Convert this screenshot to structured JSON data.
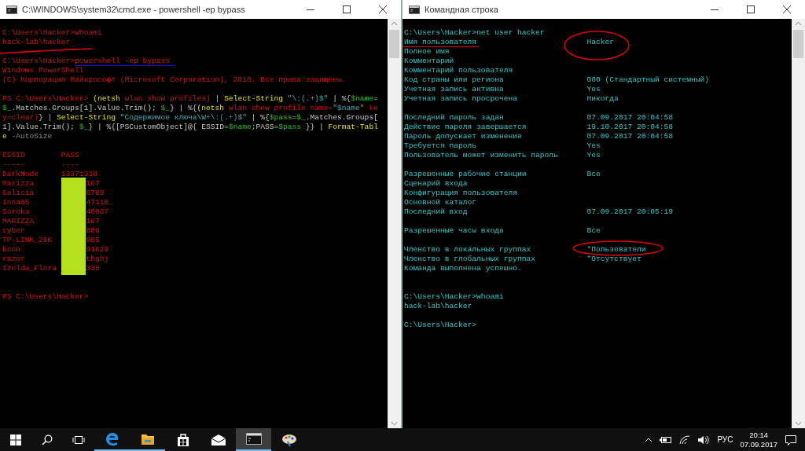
{
  "windows": [
    {
      "title": "C:\\WINDOWS\\system32\\cmd.exe - powershell  -ep bypass",
      "kind": "powershell",
      "blocks": [
        {
          "kind": "output",
          "lines": [
            [
              {
                "kind": "text",
                "text": "C:\\Users\\Hacker>whoami"
              }
            ],
            [
              {
                "kind": "text",
                "text": "hack-lab\\hacker"
              }
            ]
          ]
        },
        {
          "kind": "output",
          "lines": [
            [
              {
                "kind": "text",
                "text": "C:\\Users\\Hacker>powershell -ep bypass"
              }
            ],
            [
              {
                "kind": "text",
                "text": "Windows PowerShell"
              }
            ],
            [
              {
                "kind": "text",
                "text": "(C) Корпорация Майкрософт (Microsoft Corporation), 2016. Все права защищены."
              }
            ]
          ]
        },
        {
          "kind": "output",
          "lines": [
            [
              {
                "kind": "text",
                "text": "PS C:\\Users\\Hacker> "
              },
              {
                "kind": "cmd",
                "text": "(netsh"
              },
              {
                "kind": "text",
                "text": " wlan show profiles)"
              },
              {
                "kind": "op",
                "text": " | "
              },
              {
                "kind": "cmd",
                "text": "Select-String"
              },
              {
                "kind": "str",
                "text": " \"\\:(.+)$\""
              },
              {
                "kind": "op",
                "text": " | %{"
              },
              {
                "kind": "var",
                "text": "$name"
              },
              {
                "kind": "op",
                "text": "="
              }
            ],
            [
              {
                "kind": "var",
                "text": "$_"
              },
              {
                "kind": "op",
                "text": ".Matches.Groups[1].Value.Trim(); "
              },
              {
                "kind": "var",
                "text": "$_"
              },
              {
                "kind": "op",
                "text": "} | %{"
              },
              {
                "kind": "cmd",
                "text": "(netsh"
              },
              {
                "kind": "text",
                "text": " wlan show profile name="
              },
              {
                "kind": "str",
                "text": "\"$name\""
              },
              {
                "kind": "text",
                "text": " ke"
              }
            ],
            [
              {
                "kind": "text",
                "text": "y=clear)"
              },
              {
                "kind": "op",
                "text": "} | "
              },
              {
                "kind": "cmd",
                "text": "Select-String"
              },
              {
                "kind": "str",
                "text": " \"Содержимое ключа\\W+\\:(.+)$\""
              },
              {
                "kind": "op",
                "text": " | %{"
              },
              {
                "kind": "var",
                "text": "$pass"
              },
              {
                "kind": "op",
                "text": "="
              },
              {
                "kind": "var",
                "text": "$_"
              },
              {
                "kind": "op",
                "text": ".Matches.Groups["
              }
            ],
            [
              {
                "kind": "op",
                "text": "1].Value.Trim(); "
              },
              {
                "kind": "var",
                "text": "$_"
              },
              {
                "kind": "op",
                "text": "} | %{[PSCustomObject]@{ ESSID="
              },
              {
                "kind": "var",
                "text": "$name"
              },
              {
                "kind": "op",
                "text": ";PASS="
              },
              {
                "kind": "var",
                "text": "$pass"
              },
              {
                "kind": "op",
                "text": " }} | "
              },
              {
                "kind": "cmd",
                "text": "Format-Tabl"
              }
            ],
            [
              {
                "kind": "cmd",
                "text": "e"
              },
              {
                "kind": "param",
                "text": " -AutoSize"
              }
            ]
          ]
        },
        {
          "kind": "table",
          "table": {
            "columns": [
              "ESSID",
              "PASS"
            ],
            "rules": [
              "-----",
              "----"
            ],
            "rows": [
              {
                "essid": "DarkNode",
                "pass": "13371338",
                "redacted": false
              },
              {
                "essid": "Marizza",
                "pass": "167",
                "redacted": true
              },
              {
                "essid": "Galicia",
                "pass": "6789",
                "redacted": true
              },
              {
                "essid": "inna85",
                "pass": "47110",
                "redacted": true
              },
              {
                "essid": "Soroka",
                "pass": "40987",
                "redacted": true
              },
              {
                "essid": "MARIZZA",
                "pass": "167",
                "redacted": true
              },
              {
                "essid": "cyber",
                "pass": "806",
                "redacted": true
              },
              {
                "essid": "TP-LINK_26K",
                "pass": "985",
                "redacted": true
              },
              {
                "essid": "bnon",
                "pass": "91629",
                "redacted": true
              },
              {
                "essid": "razor",
                "pass": "thghj",
                "redacted": true
              },
              {
                "essid": "Izolda_Flora",
                "pass": "338",
                "redacted": true
              }
            ]
          }
        },
        {
          "kind": "output",
          "lines": [
            [
              {
                "kind": "text",
                "text": "PS C:\\Users\\Hacker>"
              }
            ]
          ]
        }
      ]
    },
    {
      "title": "Командная строка",
      "kind": "cmd",
      "blocks": [
        {
          "kind": "output",
          "rows": [
            {
              "label": "C:\\Users\\Hacker>net user hacker"
            },
            {
              "label": "Имя пользователя",
              "value": "Hacker"
            },
            {
              "label": "Полное имя"
            },
            {
              "label": "Комментарий"
            },
            {
              "label": "Комментарий пользователя"
            },
            {
              "label": "Код страны или региона",
              "value": "000 (Стандартный системный)"
            },
            {
              "label": "Учетная запись активна",
              "value": "Yes"
            },
            {
              "label": "Учетная запись просрочена",
              "value": "Никогда"
            }
          ]
        },
        {
          "kind": "output",
          "rows": [
            {
              "label": "Последний пароль задан",
              "value": "07.09.2017 20:04:58"
            },
            {
              "label": "Действие пароля завершается",
              "value": "19.10.2017 20:04:58"
            },
            {
              "label": "Пароль допускает изменение",
              "value": "07.09.2017 20:04:58"
            },
            {
              "label": "Требуется пароль",
              "value": "Yes"
            },
            {
              "label": "Пользователь может изменить пароль",
              "value": "Yes"
            }
          ]
        },
        {
          "kind": "output",
          "rows": [
            {
              "label": "Разрешенные рабочие станции",
              "value": "Все"
            },
            {
              "label": "Сценарий входа"
            },
            {
              "label": "Конфигурация пользователя"
            },
            {
              "label": "Основной каталог"
            },
            {
              "label": "Последний вход",
              "value": "07.09.2017 20:05:19"
            }
          ]
        },
        {
          "kind": "output",
          "rows": [
            {
              "label": "Разрешенные часы входа",
              "value": "Все"
            }
          ]
        },
        {
          "kind": "summary",
          "rows": [
            {
              "label": "Членство в локальных группах",
              "value": "*Пользователи"
            },
            {
              "label": "Членство в глобальных группах",
              "value": "*Отсутствует"
            },
            {
              "label": "Команда выполнена успешно."
            }
          ]
        },
        {
          "kind": "output",
          "rows": [
            {
              "label": "C:\\Users\\Hacker>whoami"
            },
            {
              "label": "hack-lab\\hacker"
            }
          ]
        },
        {
          "kind": "output",
          "rows": [
            {
              "label": "C:\\Users\\Hacker>"
            }
          ]
        }
      ]
    }
  ],
  "taskbar": {
    "apps": [
      {
        "kind": "edge",
        "running": true,
        "active": false
      },
      {
        "kind": "folder",
        "running": true,
        "active": false
      },
      {
        "kind": "store",
        "running": false,
        "active": false
      },
      {
        "kind": "mail",
        "running": false,
        "active": false
      },
      {
        "kind": "console",
        "running": true,
        "active": true
      },
      {
        "kind": "paint",
        "running": false,
        "active": false
      }
    ],
    "language": "РУС",
    "time": "20:14",
    "date": "07.09.2017"
  }
}
